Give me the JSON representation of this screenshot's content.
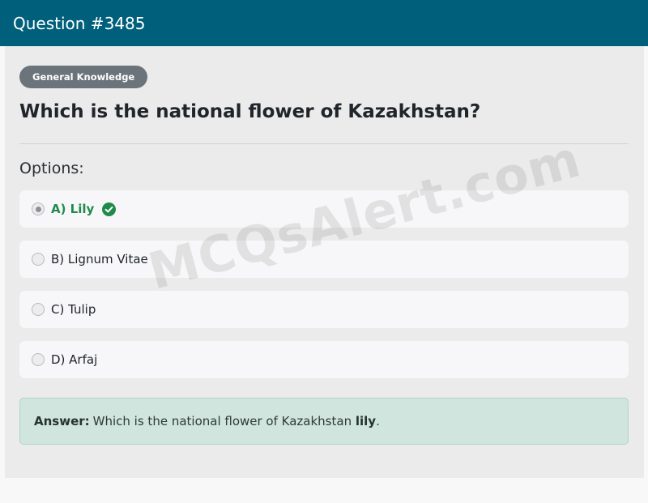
{
  "header": {
    "title": "Question #3485"
  },
  "category_badge": "General Knowledge",
  "question_text": "Which is the national flower of Kazakhstan?",
  "options_label": "Options:",
  "options": [
    {
      "label": "A) Lily",
      "selected": true,
      "correct": true
    },
    {
      "label": "B) Lignum Vitae",
      "selected": false,
      "correct": false
    },
    {
      "label": "C) Tulip",
      "selected": false,
      "correct": false
    },
    {
      "label": "D) Arfaj",
      "selected": false,
      "correct": false
    }
  ],
  "answer": {
    "label": "Answer:",
    "text": "Which is the national flower of Kazakhstan",
    "highlight": "lily",
    "suffix": "."
  },
  "watermark": "MCQsAlert.com",
  "icons": {
    "correct": "check-circle-icon"
  },
  "colors": {
    "header_bg": "#005f7a",
    "badge_bg": "#6b737b",
    "correct_green": "#1f8a4c",
    "answer_bg": "#d0e5de"
  }
}
